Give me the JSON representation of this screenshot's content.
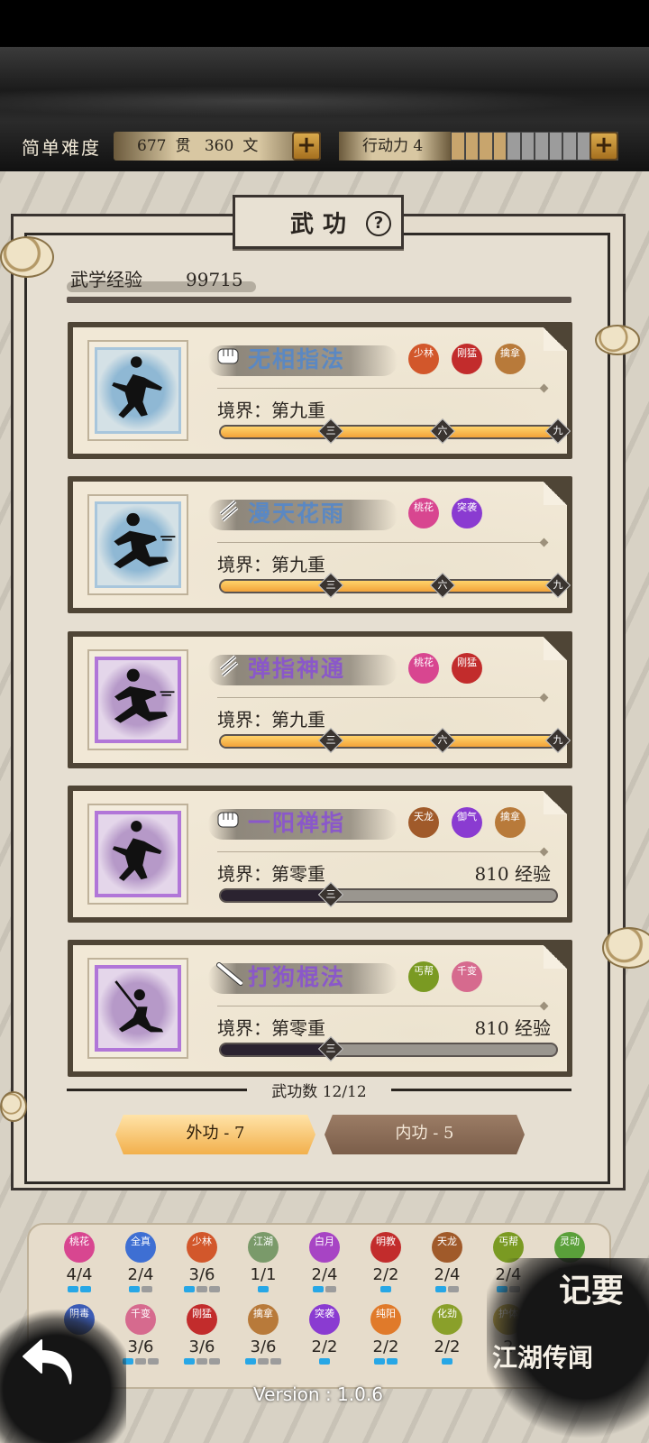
{
  "header": {
    "difficulty": "简单难度",
    "money": {
      "guan": "677",
      "guan_unit": "贯",
      "wen": "360",
      "wen_unit": "文"
    },
    "action_label": "行动力 4",
    "action_points": 4,
    "action_points_max": 12
  },
  "panel": {
    "title": "武功",
    "exp_label": "武学经验",
    "exp_value": "99715",
    "skill_count": "武功数 12/12",
    "tabs": [
      {
        "label": "外功 - 7",
        "active": true
      },
      {
        "label": "内功 - 5",
        "active": false
      }
    ]
  },
  "skills": [
    {
      "name": "无相指法",
      "name_color": "blue",
      "type_icon": "fist-icon",
      "realm": "境界：第九重",
      "exp_need": "",
      "progress": 1.0,
      "seals": [
        {
          "text": "少林",
          "color": "#d2572b"
        },
        {
          "text": "刚猛",
          "color": "#c22c2c"
        },
        {
          "text": "擒拿",
          "color": "#b87a3a"
        }
      ]
    },
    {
      "name": "漫天花雨",
      "name_color": "blue",
      "type_icon": "dart-icon",
      "realm": "境界：第九重",
      "exp_need": "",
      "progress": 1.0,
      "seals": [
        {
          "text": "桃花",
          "color": "#d84690"
        },
        {
          "text": "突袭",
          "color": "#8a3bd1"
        }
      ]
    },
    {
      "name": "弹指神通",
      "name_color": "purple",
      "type_icon": "dart-icon",
      "realm": "境界：第九重",
      "exp_need": "",
      "progress": 1.0,
      "seals": [
        {
          "text": "桃花",
          "color": "#d84690"
        },
        {
          "text": "刚猛",
          "color": "#c22c2c"
        }
      ]
    },
    {
      "name": "一阳禅指",
      "name_color": "purple",
      "type_icon": "fist-icon",
      "realm": "境界：第零重",
      "exp_need": "810 经验",
      "progress": 0.33,
      "seals": [
        {
          "text": "天龙",
          "color": "#a05a2a"
        },
        {
          "text": "御气",
          "color": "#8a3bd1"
        },
        {
          "text": "擒拿",
          "color": "#b87a3a"
        }
      ]
    },
    {
      "name": "打狗棍法",
      "name_color": "purple",
      "type_icon": "staff-icon",
      "realm": "境界：第零重",
      "exp_need": "810 经验",
      "progress": 0.33,
      "seals": [
        {
          "text": "丐帮",
          "color": "#7a9a22"
        },
        {
          "text": "千变",
          "color": "#d66a8e"
        }
      ]
    }
  ],
  "progress_markers": [
    "三",
    "六",
    "九"
  ],
  "factions": [
    {
      "text": "桃花",
      "color": "#d84690",
      "count": "4/4",
      "on": 2,
      "total": 2
    },
    {
      "text": "全真",
      "color": "#3e6fd3",
      "count": "2/4",
      "on": 1,
      "total": 2
    },
    {
      "text": "少林",
      "color": "#d2572b",
      "count": "3/6",
      "on": 1,
      "total": 3
    },
    {
      "text": "江湖",
      "color": "#7a9a6a",
      "count": "1/1",
      "on": 1,
      "total": 1
    },
    {
      "text": "白月",
      "color": "#a744c4",
      "count": "2/4",
      "on": 1,
      "total": 2
    },
    {
      "text": "明教",
      "color": "#c22c2c",
      "count": "2/2",
      "on": 1,
      "total": 1
    },
    {
      "text": "天龙",
      "color": "#a05a2a",
      "count": "2/4",
      "on": 1,
      "total": 2
    },
    {
      "text": "丐帮",
      "color": "#7a9a22",
      "count": "2/4",
      "on": 1,
      "total": 2
    },
    {
      "text": "灵动",
      "color": "#5aa03a",
      "count": "3/6",
      "on": 1,
      "total": 3
    },
    {
      "text": "阴毒",
      "color": "#3b5bb5",
      "count": "",
      "on": 0,
      "total": 0
    },
    {
      "text": "千变",
      "color": "#d66a8e",
      "count": "3/6",
      "on": 1,
      "total": 3
    },
    {
      "text": "刚猛",
      "color": "#c22c2c",
      "count": "3/6",
      "on": 1,
      "total": 3
    },
    {
      "text": "擒拿",
      "color": "#b87a3a",
      "count": "3/6",
      "on": 1,
      "total": 3
    },
    {
      "text": "突袭",
      "color": "#8a3bd1",
      "count": "2/2",
      "on": 1,
      "total": 1
    },
    {
      "text": "纯阳",
      "color": "#e07a2a",
      "count": "2/2",
      "on": 2,
      "total": 2
    },
    {
      "text": "化劲",
      "color": "#8aa02a",
      "count": "2/2",
      "on": 1,
      "total": 1
    },
    {
      "text": "护体",
      "color": "#b8a040",
      "count": "2",
      "on": 0,
      "total": 0
    },
    {
      "text": "阴毒",
      "color": "#3b5bb5",
      "count": "",
      "on": 0,
      "total": 0
    }
  ],
  "corner": {
    "notes": "记要",
    "rumors_1": "江湖",
    "rumors_2": "传闻"
  },
  "version": "Version : 1.0.6"
}
